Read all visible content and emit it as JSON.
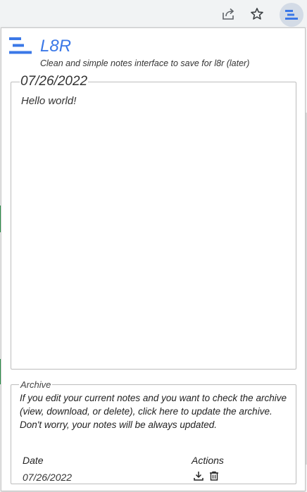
{
  "app": {
    "title": "L8R",
    "subtitle": "Clean and simple notes interface to save for l8r (later)",
    "accent_color": "#3b78e7"
  },
  "toolbar": {
    "icons": [
      "share-icon",
      "star-icon",
      "l8r-extension-icon"
    ]
  },
  "current_note": {
    "date": "07/26/2022",
    "text": "Hello world!"
  },
  "archive": {
    "legend": "Archive",
    "description_prefix": "If you edit your current notes and you want to check the archive (view, download, or delete), ",
    "update_link": "click here to update the archive.",
    "description_suffix": " Don't worry, your notes will be always updated.",
    "columns": [
      "Date",
      "Actions"
    ],
    "rows": [
      {
        "date": "07/26/2022",
        "actions": [
          "download-icon",
          "trash-icon"
        ]
      }
    ]
  }
}
